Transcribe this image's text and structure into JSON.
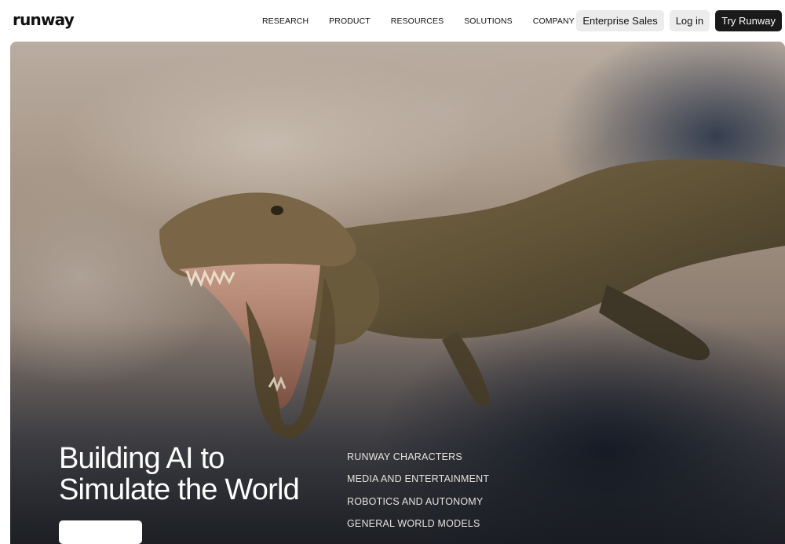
{
  "brand": {
    "logo_text": "runway"
  },
  "nav": {
    "items": [
      {
        "label": "RESEARCH"
      },
      {
        "label": "PRODUCT"
      },
      {
        "label": "RESOURCES"
      },
      {
        "label": "SOLUTIONS"
      },
      {
        "label": "COMPANY"
      }
    ]
  },
  "actions": {
    "enterprise_label": "Enterprise Sales",
    "login_label": "Log in",
    "try_label": "Try Runway"
  },
  "hero": {
    "headline_line1": "Building AI to",
    "headline_line2": "Simulate the World",
    "links": [
      {
        "label": "RUNWAY CHARACTERS"
      },
      {
        "label": "MEDIA AND ENTERTAINMENT"
      },
      {
        "label": "ROBOTICS AND AUTONOMY"
      },
      {
        "label": "GENERAL WORLD MODELS"
      }
    ]
  },
  "colors": {
    "dark_button": "#1a1a1a",
    "light_button": "#ececec"
  }
}
